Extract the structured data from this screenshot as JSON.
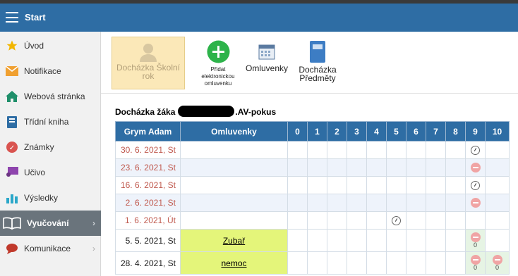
{
  "topbar": {
    "title": "Start"
  },
  "sidebar": {
    "items": [
      {
        "label": "Úvod",
        "icon": "star-icon"
      },
      {
        "label": "Notifikace",
        "icon": "envelope-icon"
      },
      {
        "label": "Webová stránka",
        "icon": "house-icon"
      },
      {
        "label": "Třídní kniha",
        "icon": "book-icon"
      },
      {
        "label": "Známky",
        "icon": "grade-icon"
      },
      {
        "label": "Učivo",
        "icon": "easel-icon"
      },
      {
        "label": "Výsledky",
        "icon": "bar-chart-icon"
      },
      {
        "label": "Vyučování",
        "icon": "open-book-icon"
      },
      {
        "label": "Komunikace",
        "icon": "chat-icon"
      }
    ]
  },
  "toolbar": {
    "skolni_rok": "Docházka Školní rok",
    "pridat": "Přidat elektronickou omluvenku",
    "omluvenky": "Omluvenky",
    "predmety": "Docházka Předměty"
  },
  "content": {
    "title_prefix": "Docházka žáka",
    "title_suffix": ".AV-pokus"
  },
  "table": {
    "headers": [
      "Grym Adam",
      "Omluvenky",
      "0",
      "1",
      "2",
      "3",
      "4",
      "5",
      "6",
      "7",
      "8",
      "9",
      "10"
    ],
    "rows": [
      {
        "date": "30. 6. 2021, St",
        "omluvenka": "",
        "marks": {
          "9": "clock"
        }
      },
      {
        "date": "23. 6. 2021, St",
        "omluvenka": "",
        "marks": {
          "9": "minus"
        }
      },
      {
        "date": "16. 6. 2021, St",
        "omluvenka": "",
        "marks": {
          "9": "clock"
        }
      },
      {
        "date": "2. 6. 2021, St",
        "omluvenka": "",
        "marks": {
          "9": "minus"
        }
      },
      {
        "date": "1. 6. 2021, Út",
        "omluvenka": "",
        "marks": {
          "5": "clock"
        }
      },
      {
        "date": "5. 5. 2021, St",
        "omluvenka": "Zubař",
        "marks": {
          "9": "minus-0"
        }
      },
      {
        "date": "28. 4. 2021, St",
        "omluvenka": "nemoc",
        "marks": {
          "9": "minus-0",
          "10": "minus-0"
        }
      }
    ],
    "mark_sub": "0"
  },
  "colors": {
    "accent": "#2e6da4",
    "past_date": "#c05a4f",
    "excuse": "#e4f57a"
  }
}
